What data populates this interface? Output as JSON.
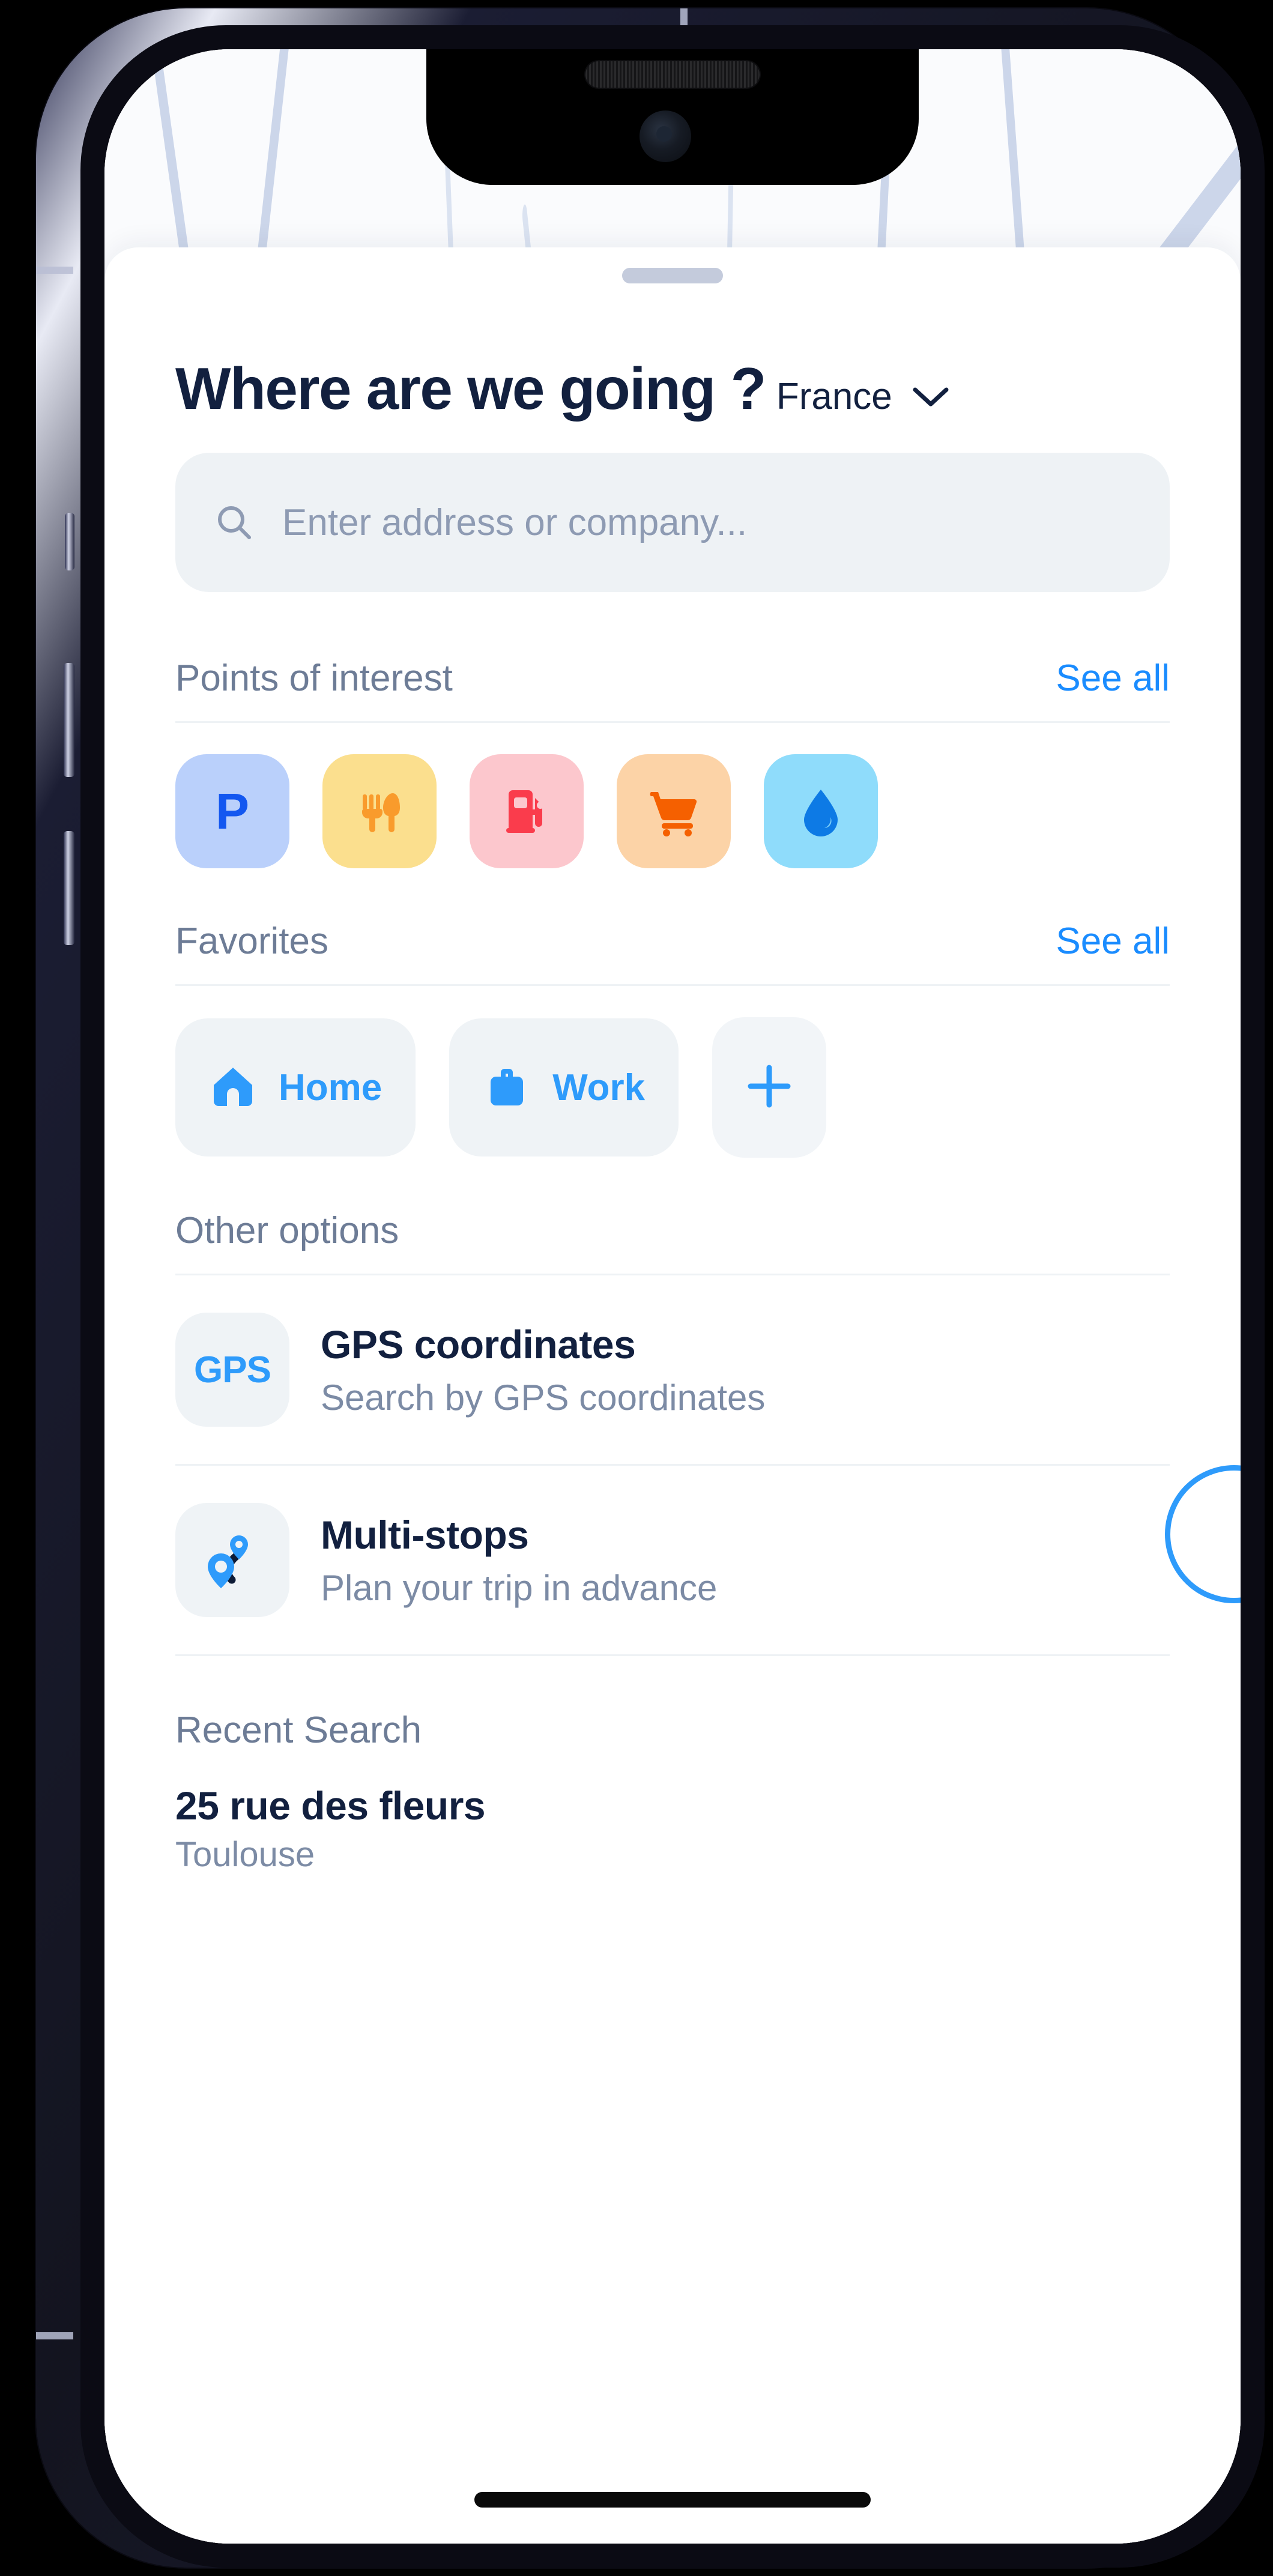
{
  "device": {
    "notch_icons": [
      "speaker-grille",
      "front-camera"
    ],
    "home_indicator": true
  },
  "sheet": {
    "grabber": "drag-handle"
  },
  "header": {
    "title": "Where are we going ?",
    "country": "France",
    "chevron": "chevron-down-icon"
  },
  "search": {
    "icon": "search-icon",
    "placeholder": "Enter address or company...",
    "value": ""
  },
  "points_of_interest": {
    "title": "Points of interest",
    "see_all": "See all",
    "items": [
      {
        "name": "parking",
        "icon": "parking-icon",
        "glyph": "P",
        "bg": "#bad0fb",
        "fg": "#1357f0"
      },
      {
        "name": "restaurant",
        "icon": "restaurant-icon",
        "glyph": "",
        "bg": "#fbdf8e",
        "fg": "#f99b2c"
      },
      {
        "name": "gas",
        "icon": "gas-pump-icon",
        "glyph": "",
        "bg": "#fcc7cd",
        "fg": "#fa3c4c"
      },
      {
        "name": "groceries",
        "icon": "shopping-cart-icon",
        "glyph": "",
        "bg": "#fcd3a7",
        "fg": "#f56000"
      },
      {
        "name": "water",
        "icon": "water-drop-icon",
        "glyph": "",
        "bg": "#8fdcfb",
        "fg": "#0d7ae5"
      }
    ]
  },
  "favorites": {
    "title": "Favorites",
    "see_all": "See all",
    "items": [
      {
        "label": "Home",
        "icon": "home-icon"
      },
      {
        "label": "Work",
        "icon": "briefcase-icon"
      }
    ],
    "add_button": {
      "icon": "plus-icon",
      "label": "+"
    }
  },
  "other_options": {
    "title": "Other options",
    "items": [
      {
        "icon": "gps-badge-icon",
        "icon_text": "GPS",
        "title": "GPS coordinates",
        "subtitle": "Search by GPS coordinates"
      },
      {
        "icon": "multi-stop-route-icon",
        "icon_text": "",
        "title": "Multi-stops",
        "subtitle": "Plan your trip in advance"
      }
    ]
  },
  "recent_search": {
    "title": "Recent Search",
    "items": [
      {
        "name": "25 rue des fleurs",
        "city": "Toulouse"
      }
    ]
  },
  "colors": {
    "accent_blue": "#2e9bfb",
    "link_blue": "#1a8cff",
    "navy": "#12203f",
    "muted": "#6d7c96",
    "field_bg": "#eef2f5"
  }
}
